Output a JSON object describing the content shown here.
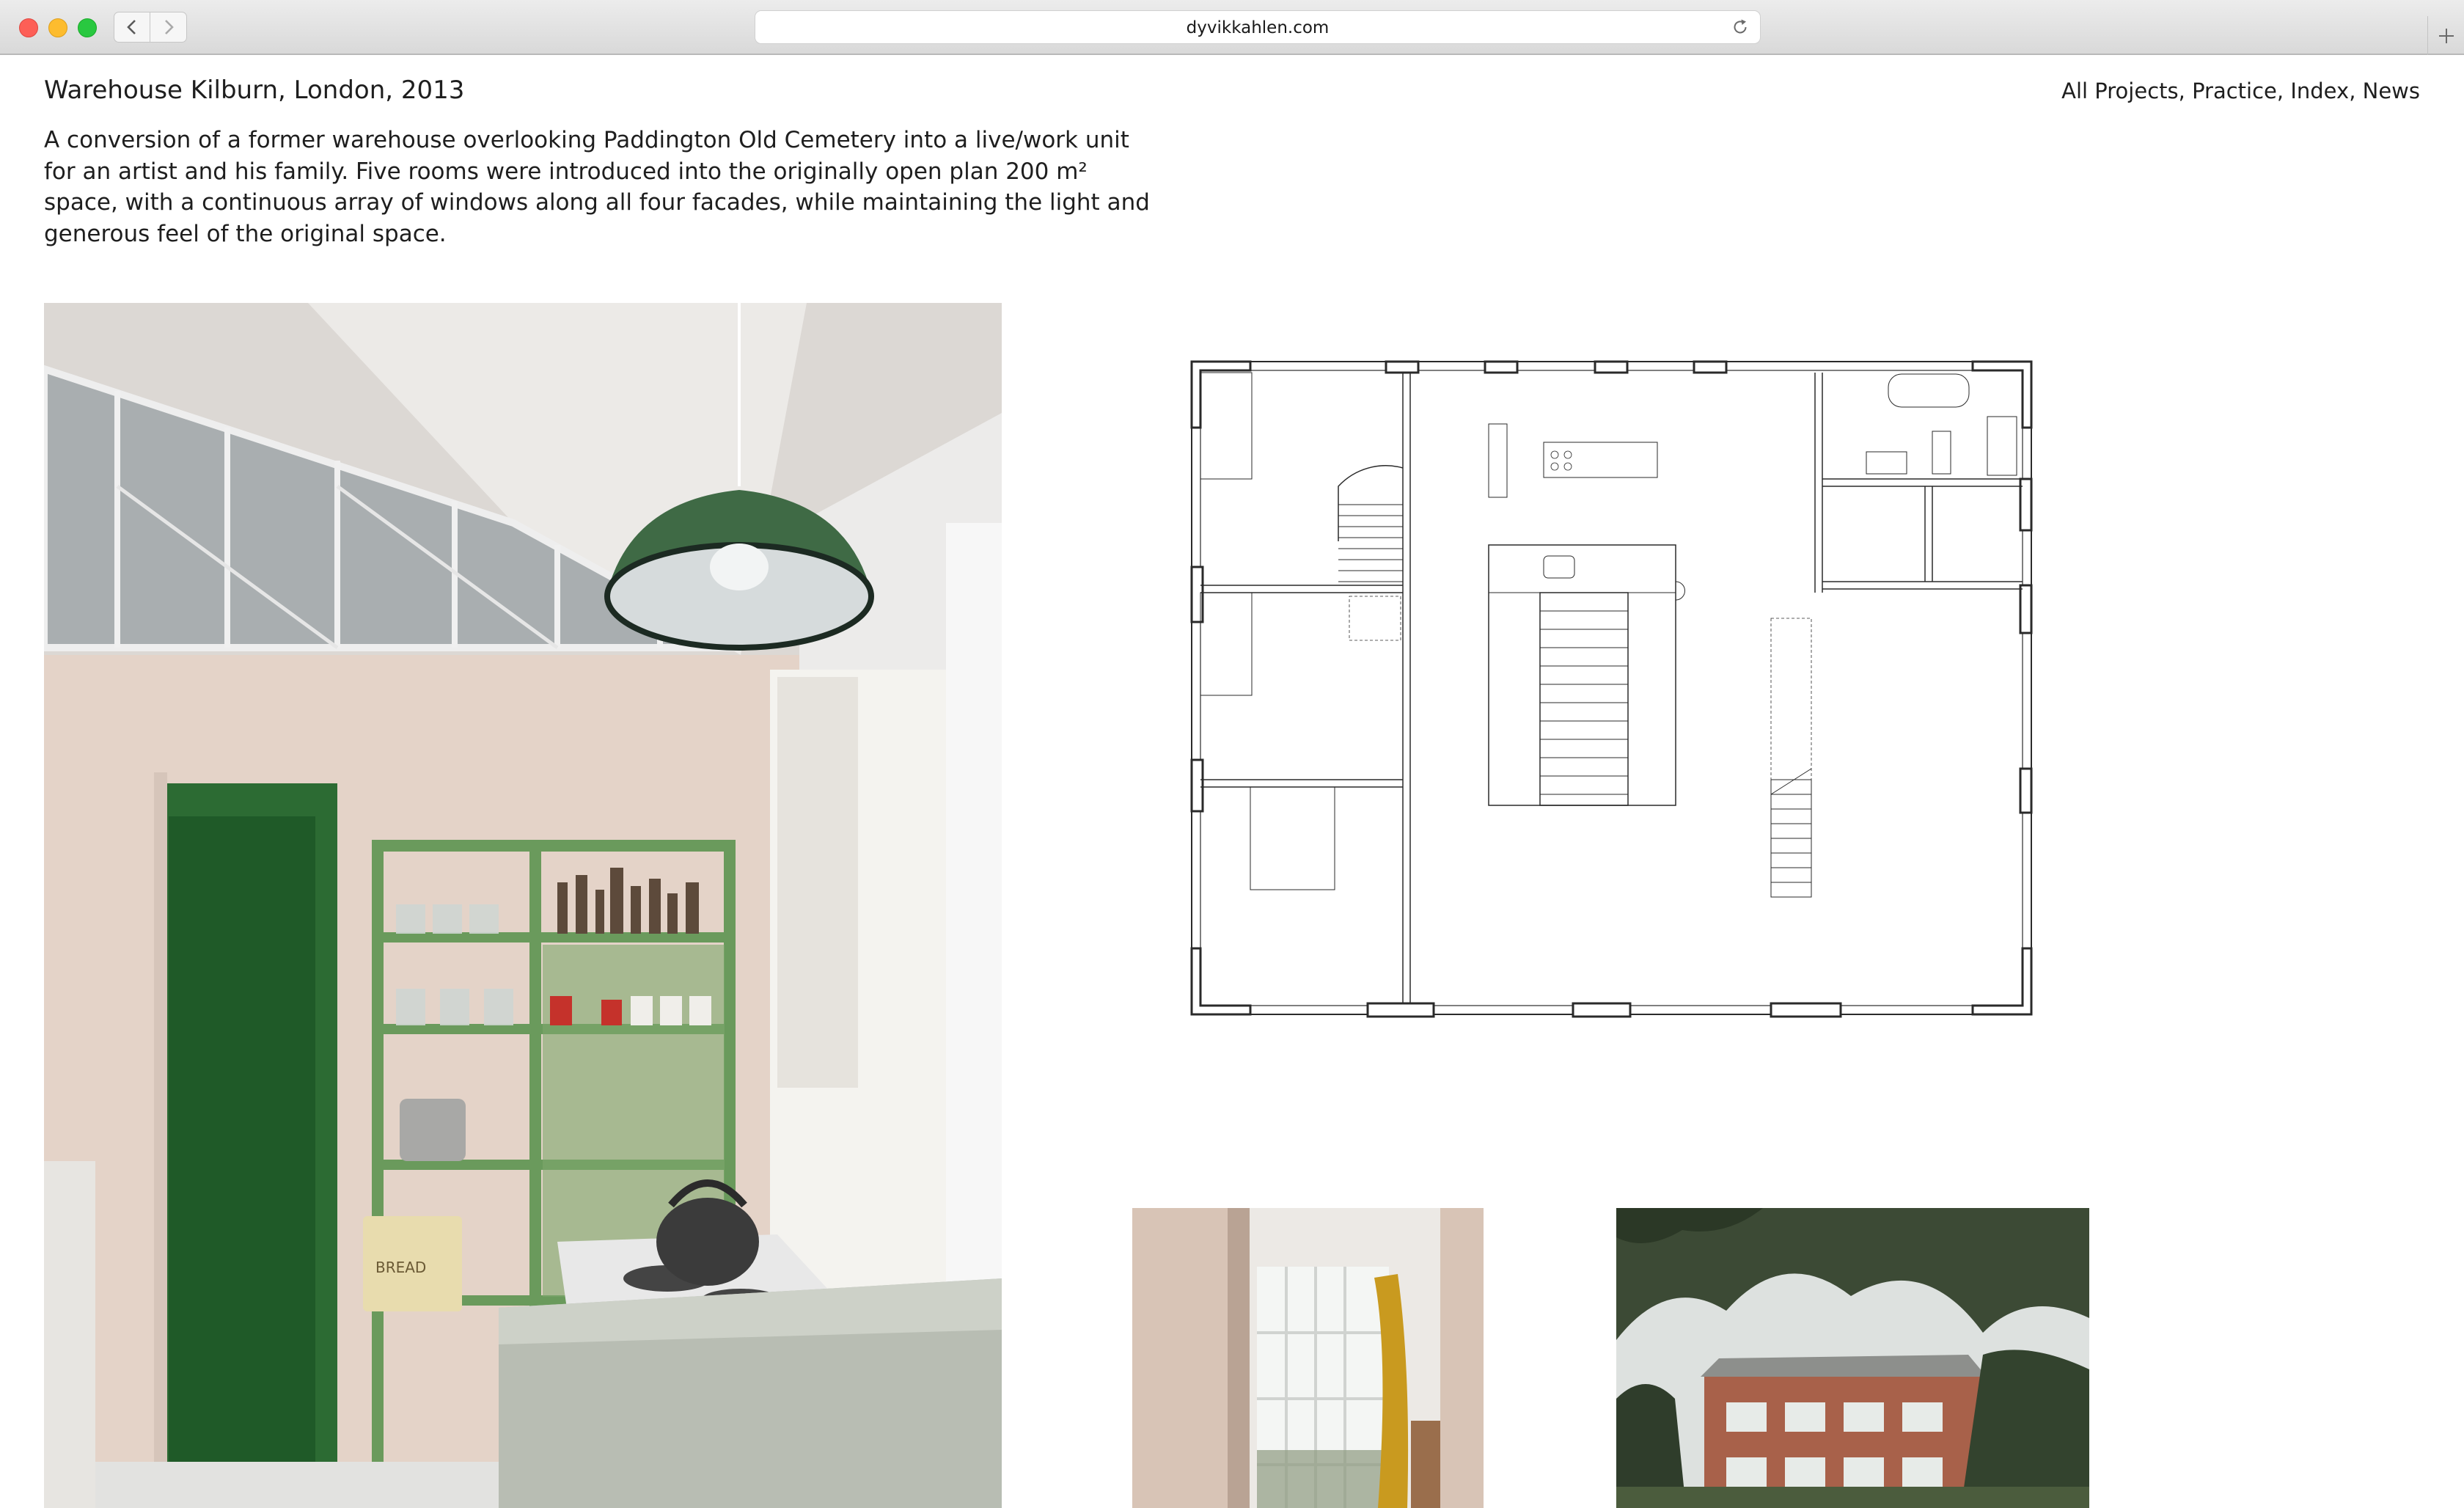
{
  "browser": {
    "url": "dyvikkahlen.com"
  },
  "page": {
    "title": "Warehouse Kilburn, London, 2013",
    "nav": {
      "all_projects": "All Projects",
      "practice": "Practice",
      "index": "Index",
      "news": "News",
      "separator": ", "
    },
    "description": "A conversion of a former warehouse overlooking Paddington Old Cemetery into a live/work unit for an artist and his family. Five rooms were introduced into the originally open plan 200 m² space, with a continuous array of windows along all four facades, while maintaining the light and generous feel of the original space."
  },
  "images": {
    "main_photo": "kitchen-interior-photo",
    "floor_plan": "floor-plan-drawing",
    "window_photo": "window-interior-photo",
    "exterior_photo": "exterior-building-photo"
  },
  "photo_labels": {
    "bread_bin": "BREAD"
  },
  "colors": {
    "text": "#1e1e1e",
    "shelf_green": "#6a9a5c",
    "door_green": "#2c6b33",
    "lamp_green": "#3f6a45",
    "plywood": "#e2cfc3",
    "curtain_mustard": "#c99a1f"
  }
}
